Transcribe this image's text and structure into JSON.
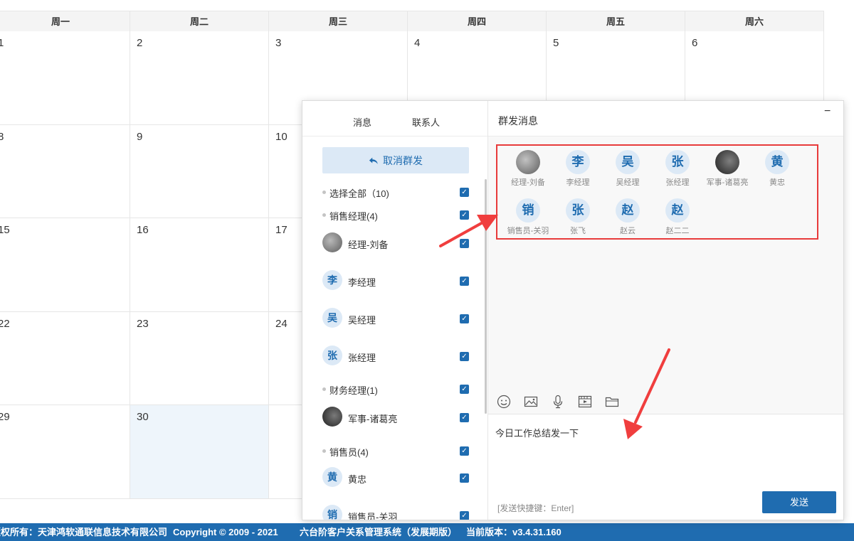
{
  "calendar": {
    "weekdays": [
      "周一",
      "周二",
      "周三",
      "周四",
      "周五",
      "周六"
    ],
    "rows": [
      [
        "1",
        "2",
        "3",
        "4",
        "5",
        "6"
      ],
      [
        "8",
        "9",
        "10",
        "",
        "",
        ""
      ],
      [
        "15",
        "16",
        "17",
        "",
        "",
        ""
      ],
      [
        "22",
        "23",
        "24",
        "",
        "",
        ""
      ],
      [
        "29",
        "30",
        "",
        "",
        "",
        ""
      ]
    ]
  },
  "footer": {
    "owner": "版权所有：天津鸿软通联信息技术有限公司",
    "copyright": "Copyright © 2009 - 2021",
    "system": "六台阶客户关系管理系统（发展期版）",
    "version": "当前版本：v3.4.31.160"
  },
  "panel": {
    "tabs": [
      "消息",
      "联系人"
    ],
    "cancel_label": "取消群发",
    "list": [
      {
        "type": "group",
        "label": "选择全部（10)"
      },
      {
        "type": "group",
        "label": "销售经理(4)"
      },
      {
        "type": "member",
        "avatar": "photo1",
        "name": "经理-刘备"
      },
      {
        "type": "member",
        "avatar": "李",
        "name": "李经理"
      },
      {
        "type": "member",
        "avatar": "吴",
        "name": "吴经理"
      },
      {
        "type": "member",
        "avatar": "张",
        "name": "张经理"
      },
      {
        "type": "group",
        "label": "财务经理(1)"
      },
      {
        "type": "member",
        "avatar": "photo2",
        "name": "军事-诸葛亮"
      },
      {
        "type": "group",
        "label": "销售员(4)"
      },
      {
        "type": "member",
        "avatar": "黄",
        "name": "黄忠"
      },
      {
        "type": "member",
        "avatar": "销",
        "name": "销售员-关羽"
      }
    ],
    "right_title": "群发消息",
    "minimize": "−",
    "recipients": [
      {
        "avatar": "photo1",
        "name": "经理-刘备"
      },
      {
        "avatar": "李",
        "name": "李经理"
      },
      {
        "avatar": "吴",
        "name": "吴经理"
      },
      {
        "avatar": "张",
        "name": "张经理"
      },
      {
        "avatar": "photo2",
        "name": "军事-诸葛亮"
      },
      {
        "avatar": "黄",
        "name": "黄忠"
      },
      {
        "avatar": "销",
        "name": "销售员-关羽"
      },
      {
        "avatar": "张",
        "name": "张飞"
      },
      {
        "avatar": "赵",
        "name": "赵云"
      },
      {
        "avatar": "赵",
        "name": "赵二二"
      }
    ],
    "toolbar_icons": [
      "emoji-icon",
      "image-icon",
      "microphone-icon",
      "video-icon",
      "folder-icon"
    ],
    "message": "今日工作总结发一下",
    "shortcut_hint": "[发送快捷键：Enter]",
    "send_label": "发送"
  },
  "colors": {
    "accent": "#1f6cb0",
    "highlight": "#e83b3b",
    "avatar_bg": "#dce9f6"
  }
}
